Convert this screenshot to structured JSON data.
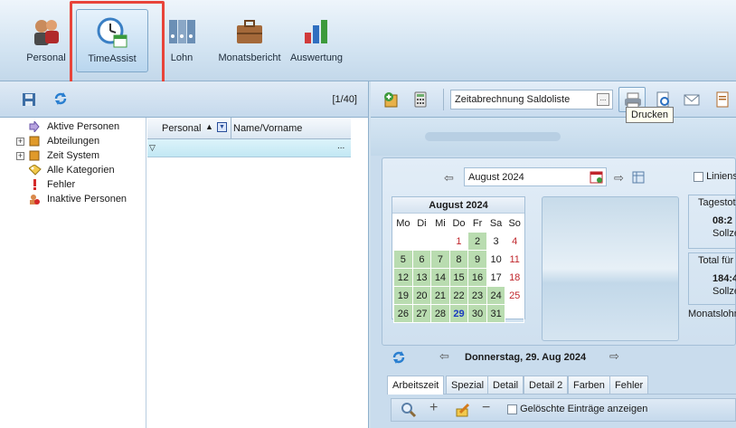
{
  "ribbon": {
    "buttons": [
      {
        "label": "Personal",
        "icon": "people-icon"
      },
      {
        "label": "TimeAssist",
        "icon": "clock-calendar-icon"
      },
      {
        "label": "Lohn",
        "icon": "binders-icon"
      },
      {
        "label": "Monatsbericht",
        "icon": "briefcase-icon"
      },
      {
        "label": "Auswertung",
        "icon": "bar-chart-icon"
      }
    ]
  },
  "left": {
    "counter": "[1/40]",
    "tree": [
      "Aktive Personen",
      "Abteilungen",
      "Zeit System",
      "Alle Kategorien",
      "Fehler",
      "Inaktive Personen"
    ],
    "grid": {
      "col1": "Personal",
      "col2": "Name/Vorname",
      "filter_btn": "..."
    }
  },
  "right": {
    "report_select": "Zeitabrechnung Saldoliste",
    "report_btn": "...",
    "tooltip": "Drucken",
    "month_field": "August 2024",
    "calendar": {
      "title": "August 2024",
      "days": [
        "Mo",
        "Di",
        "Mi",
        "Do",
        "Fr",
        "Sa",
        "So"
      ],
      "rows": [
        [
          "",
          "",
          "",
          "1",
          "2",
          "3",
          "4"
        ],
        [
          "5",
          "6",
          "7",
          "8",
          "9",
          "10",
          "11"
        ],
        [
          "12",
          "13",
          "14",
          "15",
          "16",
          "17",
          "18"
        ],
        [
          "19",
          "20",
          "21",
          "22",
          "23",
          "24",
          "25"
        ],
        [
          "26",
          "27",
          "28",
          "29",
          "30",
          "31",
          ""
        ]
      ]
    },
    "lines_label": "Liniens",
    "tagestotal": {
      "title": "Tagestot",
      "value": "08:2",
      "sub": "Sollze"
    },
    "total": {
      "title": "Total für",
      "value": "184:4",
      "sub": "Sollze"
    },
    "monatslohn": "Monatslohn",
    "date_nav": "Donnerstag, 29. Aug 2024",
    "tabs": [
      "Arbeitszeit",
      "Spezial",
      "Detail",
      "Detail 2",
      "Farben",
      "Fehler"
    ],
    "deleted_label": "Gelöschte Einträge anzeigen"
  },
  "colors": {
    "accent": "#e8443a",
    "calendar_green": "#b9dcb0",
    "today_blue": "#1a3bbf",
    "weekend_red": "#c0262c"
  }
}
